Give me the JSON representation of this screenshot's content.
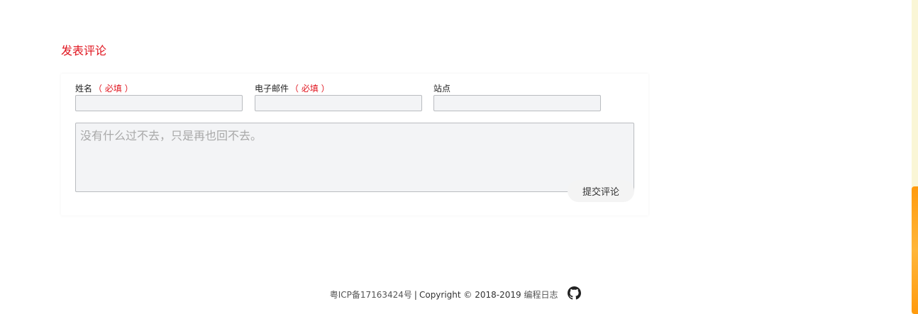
{
  "comment_form": {
    "title": "发表评论",
    "name_label": "姓名",
    "email_label": "电子邮件",
    "site_label": "站点",
    "required_mark": "（ 必填 ）",
    "name_value": "",
    "email_value": "",
    "site_value": "",
    "comment_placeholder": "没有什么过不去，只是再也回不去。",
    "submit_label": "提交评论"
  },
  "footer": {
    "icp": "粤ICP备17163424号",
    "separator": "|",
    "copyright": "Copyright © 2018-2019",
    "brand": "编程日志",
    "github_icon": "github-icon"
  },
  "colors": {
    "accent": "#e0141e",
    "scroll_thumb": "#ff9a0d",
    "scroll_track": "#faf6d6"
  },
  "scroll": {
    "position_fraction": 0.98
  }
}
